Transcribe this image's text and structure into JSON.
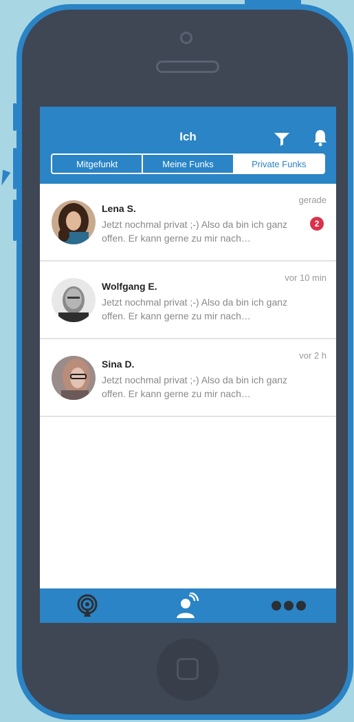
{
  "header": {
    "title": "Ich",
    "filter_icon": "filter-icon",
    "bell_icon": "bell-icon"
  },
  "segments": [
    {
      "label": "Mitgefunkt",
      "active": false
    },
    {
      "label": "Meine Funks",
      "active": false
    },
    {
      "label": "Private Funks",
      "active": true
    }
  ],
  "messages": [
    {
      "name": "Lena S.",
      "text": "Jetzt nochmal privat ;-) Also da bin ich ganz offen. Er kann gerne zu mir nach…",
      "time": "gerade",
      "badge": "2"
    },
    {
      "name": "Wolfgang E.",
      "text": "Jetzt nochmal privat ;-) Also da bin ich ganz offen. Er kann gerne zu mir nach…",
      "time": "vor 10 min"
    },
    {
      "name": "Sina D.",
      "text": "Jetzt nochmal privat ;-) Also da bin ich ganz offen. Er kann gerne zu mir nach…",
      "time": "vor 2 h"
    }
  ],
  "tabbar": {
    "items": [
      "broadcast-icon",
      "user-signal-icon",
      "more-icon"
    ]
  },
  "colors": {
    "primary": "#2a84c6",
    "badge": "#d9324b",
    "phone_body": "#3f4654",
    "background": "#a9d6e3"
  }
}
